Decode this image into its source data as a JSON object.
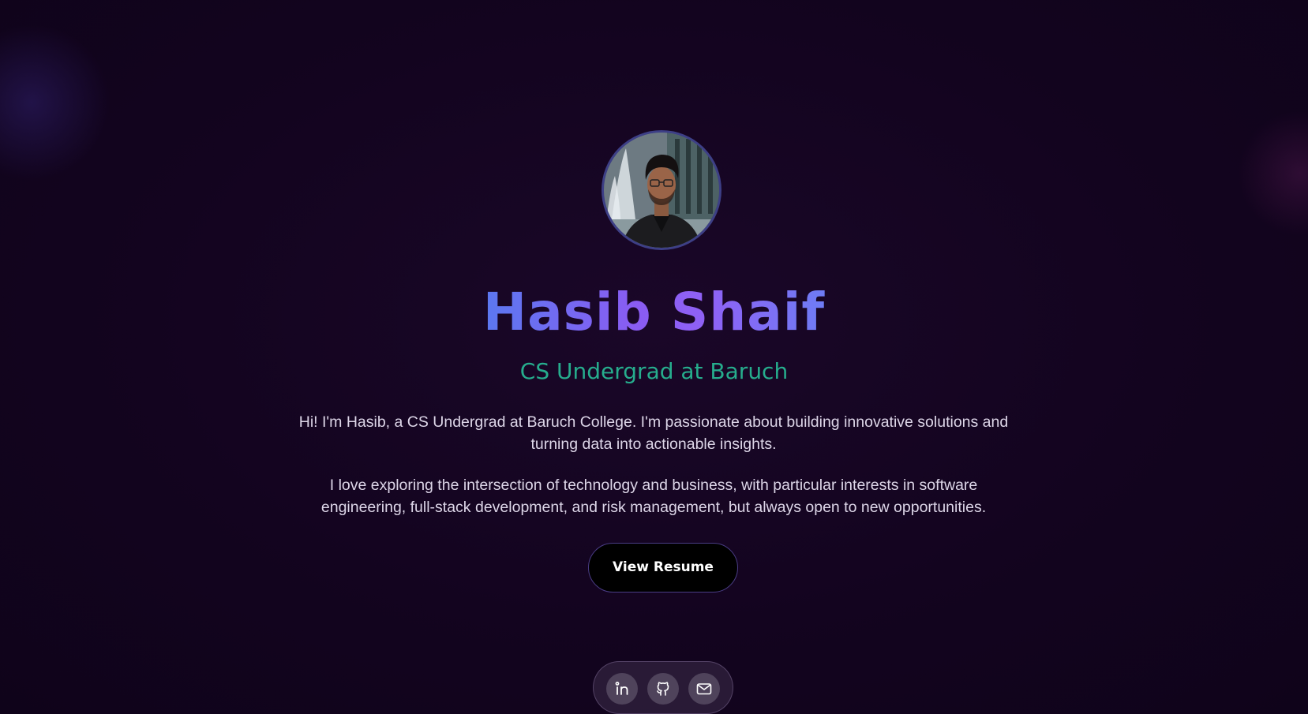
{
  "profile": {
    "name": "Hasib Shaif",
    "subtitle": "CS Undergrad at Baruch",
    "bio": [
      "Hi! I'm Hasib, a CS Undergrad at Baruch College. I'm passionate about building innovative solutions and turning data into actionable insights.",
      "I love exploring the intersection of technology and business, with particular interests in software engineering, full-stack development, and risk management, but always open to new opportunities."
    ],
    "avatar_icon": "profile-photo"
  },
  "actions": {
    "resume_label": "View Resume"
  },
  "social": [
    {
      "icon": "linkedin-icon"
    },
    {
      "icon": "github-icon"
    },
    {
      "icon": "mail-icon"
    }
  ],
  "colors": {
    "background": "#13041f",
    "name_gradient_start": "#5b78f0",
    "name_gradient_end": "#8f61f5",
    "subtitle": "#26ad8d",
    "body_text": "#ddd6e8",
    "button_bg": "#000000"
  }
}
